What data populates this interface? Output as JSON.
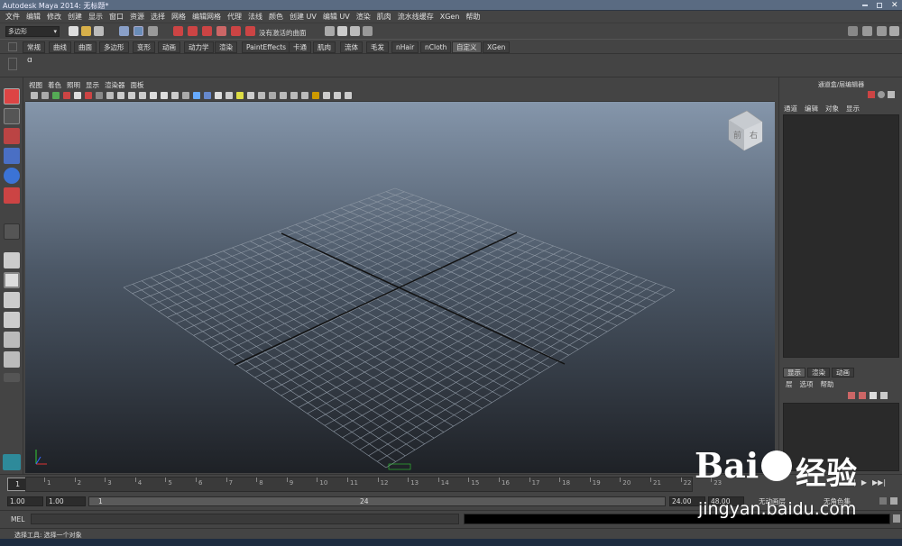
{
  "window": {
    "title": "Autodesk Maya 2014: 无标题*"
  },
  "menubar": [
    "文件",
    "编辑",
    "修改",
    "创建",
    "显示",
    "窗口",
    "资源",
    "选择",
    "网格",
    "编辑网格",
    "代理",
    "法线",
    "颜色",
    "创建 UV",
    "编辑 UV",
    "渲染",
    "肌肉",
    "流水线缓存",
    "XGen",
    "帮助"
  ],
  "statusline": {
    "menu_set": "多边形",
    "live_surface": "没有激活的曲面"
  },
  "shelf_tabs": [
    "常规",
    "曲线",
    "曲面",
    "多边形",
    "变形",
    "动画",
    "动力学",
    "渲染",
    "PaintEffects",
    "卡通",
    "肌肉",
    "流体",
    "毛发",
    "nHair",
    "nCloth",
    "自定义",
    "XGen"
  ],
  "shelf_active": "自定义",
  "viewport": {
    "menu": [
      "视图",
      "着色",
      "照明",
      "显示",
      "渲染器",
      "面板"
    ],
    "viewcube": {
      "front": "前",
      "right": "右"
    }
  },
  "channel_box": {
    "title": "通道盒/层编辑器",
    "menu": [
      "通道",
      "编辑",
      "对象",
      "显示"
    ],
    "layer_tabs": [
      "显示",
      "渲染",
      "动画"
    ],
    "layer_tab_active": "显示",
    "layer_menu": [
      "层",
      "选项",
      "帮助"
    ]
  },
  "time_slider": {
    "ticks": [
      "1",
      "2",
      "3",
      "4",
      "5",
      "6",
      "7",
      "8",
      "9",
      "10",
      "11",
      "12",
      "13",
      "14",
      "15",
      "16",
      "17",
      "18",
      "19",
      "20",
      "21",
      "22",
      "23"
    ],
    "current_frame": "1"
  },
  "range_slider": {
    "start_time": "1.00",
    "playback_start": "1.00",
    "range_left": "1",
    "range_right": "24",
    "playback_end": "24.00",
    "end_time": "48.00",
    "anim_layer": "无动画层",
    "char_set": "无角色集"
  },
  "command_line": {
    "label": "MEL"
  },
  "help_line": {
    "text": "选择工具: 选择一个对象"
  },
  "watermark": {
    "brand": "Bai",
    "brand_suffix": "经验",
    "url": "jingyan.baidu.com"
  }
}
